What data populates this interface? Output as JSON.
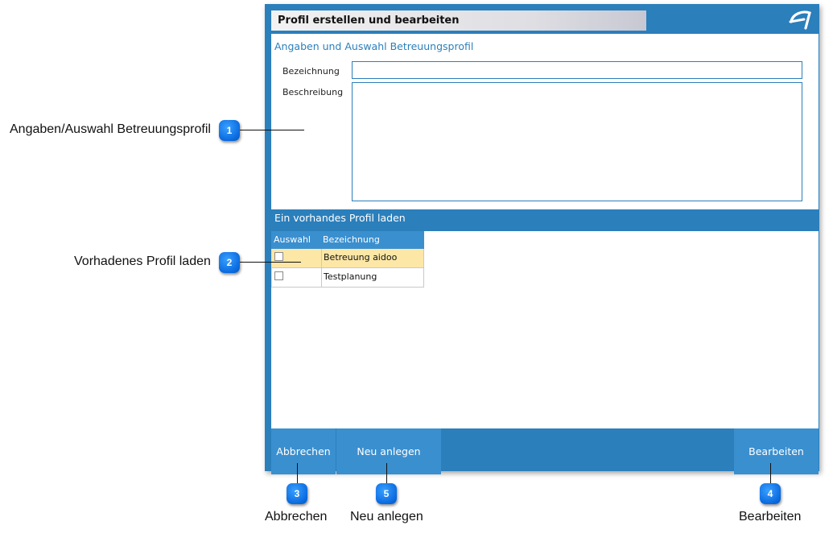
{
  "window": {
    "title": "Profil erstellen und bearbeiten",
    "logo_icon": "brand-logo-icon"
  },
  "details": {
    "section_title": "Angaben und Auswahl Betreuungsprofil",
    "name_label": "Bezeichnung",
    "name_value": "",
    "description_label": "Beschreibung",
    "description_value": ""
  },
  "profiles": {
    "section_title": "Ein vorhandes Profil laden",
    "columns": [
      "Auswahl",
      "Bezeichnung"
    ],
    "rows": [
      {
        "checked": false,
        "name": "Betreuung aidoo",
        "selected": true
      },
      {
        "checked": false,
        "name": "Testplanung",
        "selected": false
      }
    ]
  },
  "buttons": {
    "cancel": "Abbrechen",
    "create": "Neu anlegen",
    "edit": "Bearbeiten"
  },
  "callouts": [
    {
      "number": "1",
      "label": "Angaben/Auswahl Betreuungsprofil"
    },
    {
      "number": "2",
      "label": "Vorhadenes Profil laden"
    },
    {
      "number": "3",
      "label": "Abbrechen"
    },
    {
      "number": "4",
      "label": "Bearbeiten"
    },
    {
      "number": "5",
      "label": "Neu anlegen"
    }
  ],
  "colors": {
    "accent": "#2b7fbb",
    "button": "#3a8fcf",
    "selected_row": "#fce7a6",
    "badge": "#0a6be0"
  }
}
